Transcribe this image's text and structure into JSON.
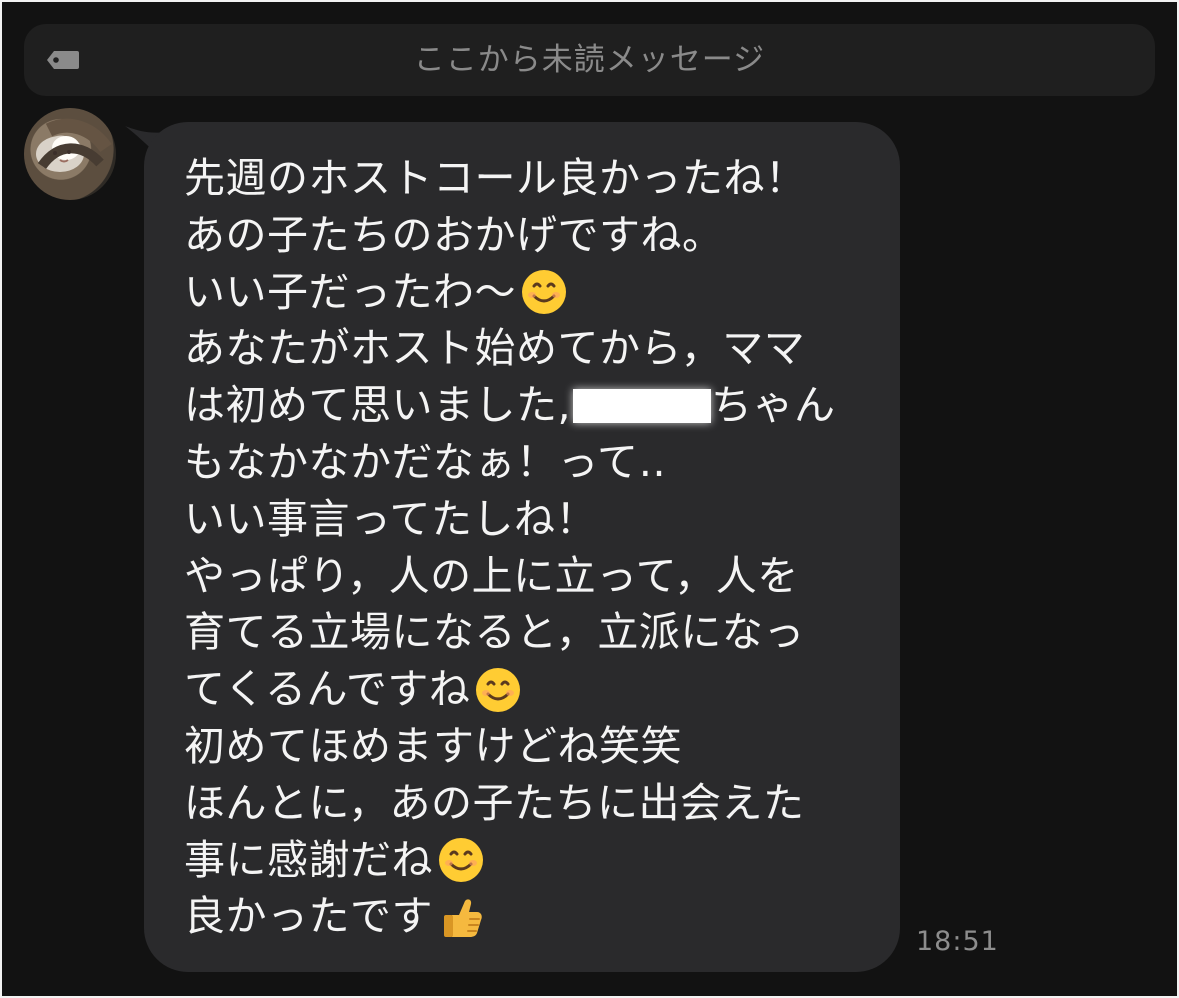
{
  "chat": {
    "unread_label": "ここから未読メッセージ",
    "message": {
      "lines": [
        "先週のホストコール良かったね！",
        "あの子たちのおかげですね。",
        "いい子だったわ〜",
        "あなたがホスト始めてから，ママ",
        "は初めて思いました,",
        "ちゃん",
        "もなかなかだなぁ！って‥",
        "いい事言ってたしね！",
        "やっぱり，人の上に立って，人を",
        "育てる立場になると，立派になっ",
        "てくるんですね",
        "初めてほめますけどね笑笑",
        "ほんとに，あの子たちに出会えた",
        "事に感謝だね",
        "良かったです"
      ],
      "timestamp": "18:51"
    }
  },
  "icons": {
    "unread": "tag-icon",
    "smile": "smiling-face-icon",
    "thumbs_up": "thumbs-up-icon"
  }
}
